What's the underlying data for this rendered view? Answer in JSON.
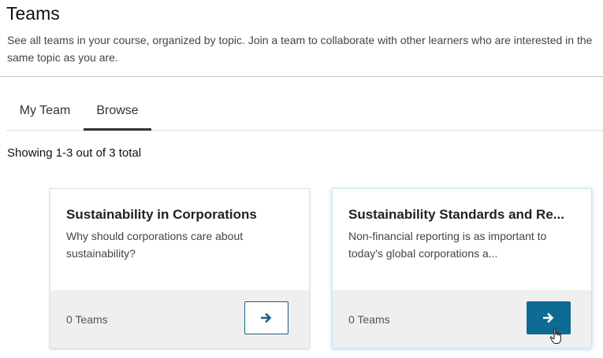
{
  "header": {
    "title": "Teams",
    "description": "See all teams in your course, organized by topic. Join a team to collaborate with other learners who are interested in the same topic as you are."
  },
  "tabs": [
    {
      "label": "My Team",
      "selected": false
    },
    {
      "label": "Browse",
      "selected": true
    }
  ],
  "results": {
    "summary": "Showing 1-3 out of 3 total"
  },
  "topics": [
    {
      "title": "Sustainability in Corporations",
      "description": "Why should corporations care about sustainability?",
      "team_count": "0 Teams",
      "button_icon": "arrow-right-icon"
    },
    {
      "title": "Sustainability Standards and Re...",
      "description": "Non-financial reporting is as important to today's global corporations a...",
      "team_count": "0 Teams",
      "button_icon": "arrow-right-icon"
    }
  ],
  "colors": {
    "accent": "#0e6b94",
    "footer_bg": "#efefef"
  }
}
